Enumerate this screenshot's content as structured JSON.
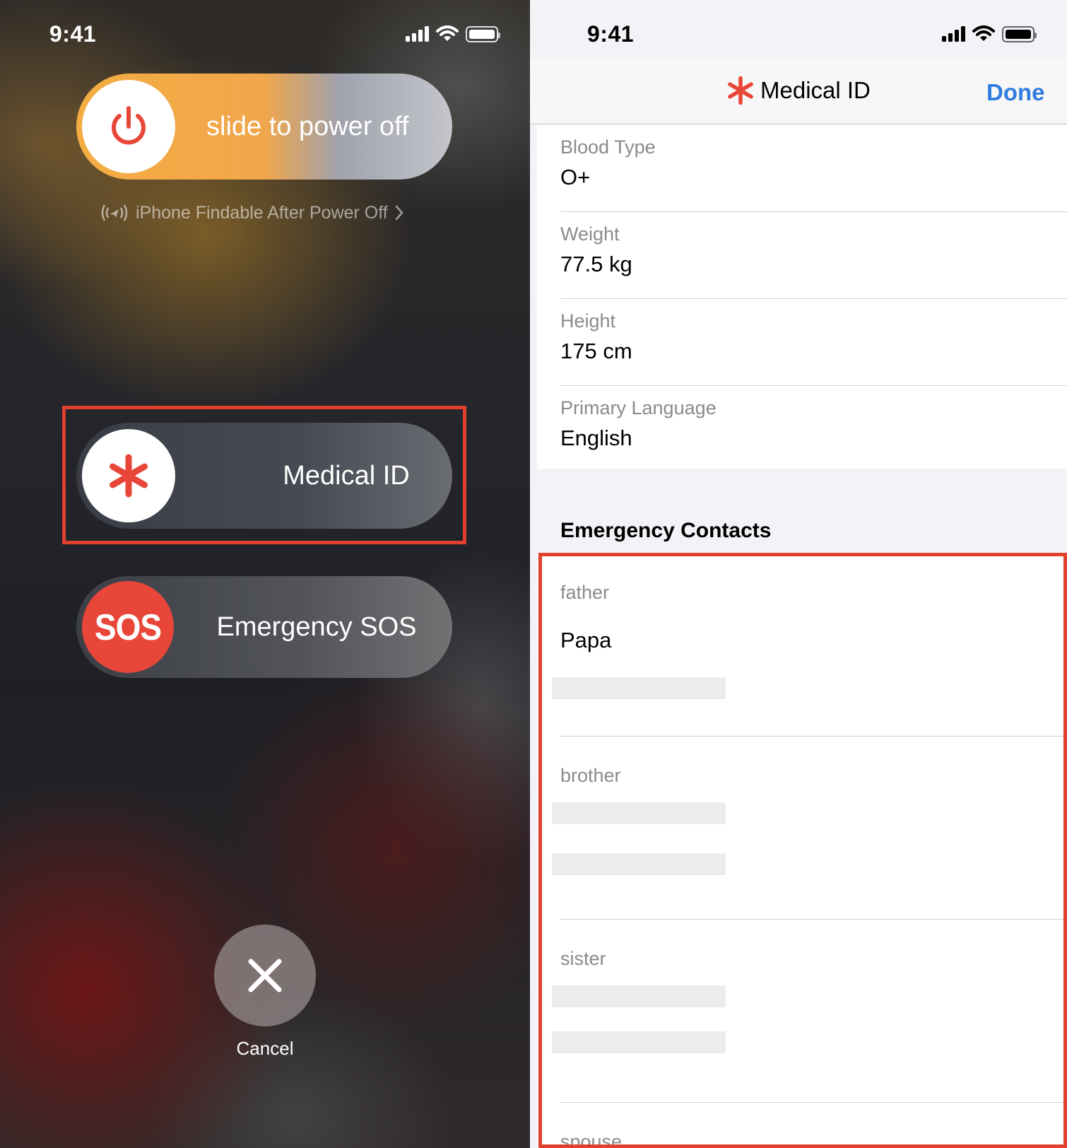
{
  "colors": {
    "accent_red": "#e9463a",
    "highlight_red": "#e0402c",
    "link_blue": "#2f7ce0",
    "secondary_text": "#8a8a8e"
  },
  "left": {
    "status": {
      "time": "9:41"
    },
    "power_slider": {
      "label": "slide to power off",
      "icon": "power-icon"
    },
    "findable": {
      "text": "iPhone Findable After Power Off",
      "icon": "findable-wave-icon"
    },
    "medical_slider": {
      "label": "Medical ID",
      "icon": "asterisk-icon"
    },
    "sos_slider": {
      "badge": "SOS",
      "label": "Emergency SOS"
    },
    "cancel": {
      "label": "Cancel",
      "icon": "close-icon"
    }
  },
  "right": {
    "status": {
      "time": "9:41"
    },
    "nav": {
      "title": "Medical ID",
      "done_label": "Done",
      "icon": "asterisk-icon"
    },
    "info": [
      {
        "label": "Blood Type",
        "value": "O+"
      },
      {
        "label": "Weight",
        "value": "77.5 kg"
      },
      {
        "label": "Height",
        "value": "175 cm"
      },
      {
        "label": "Primary Language",
        "value": "English"
      }
    ],
    "emergency_contacts": {
      "header": "Emergency Contacts",
      "contacts": [
        {
          "relation": "father",
          "name": "Papa"
        },
        {
          "relation": "brother",
          "name": ""
        },
        {
          "relation": "sister",
          "name": ""
        },
        {
          "relation": "spouse",
          "name": ""
        }
      ]
    }
  }
}
